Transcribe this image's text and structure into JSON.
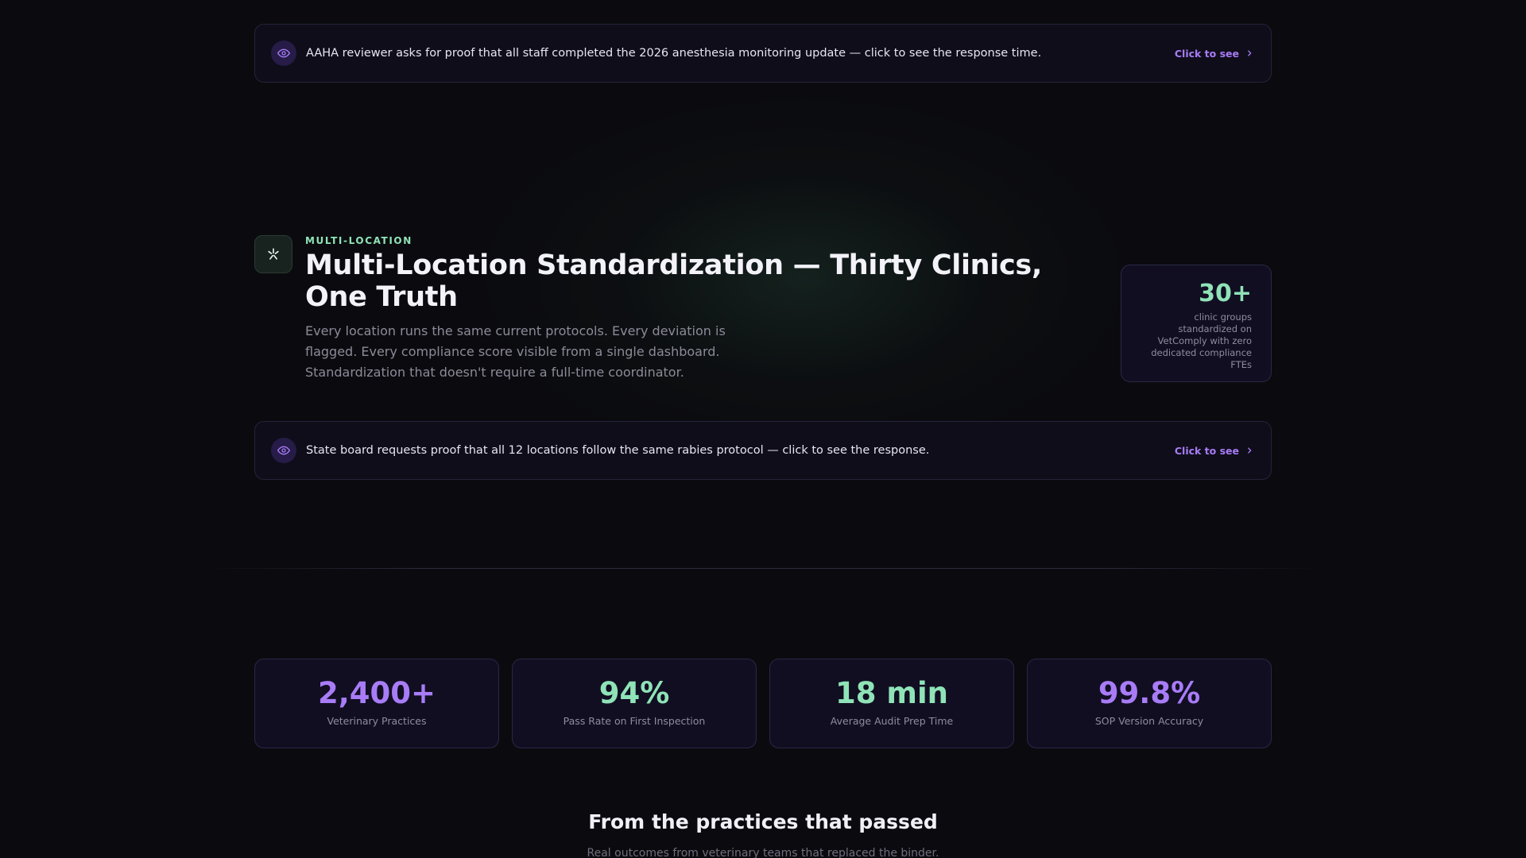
{
  "callout_top": {
    "icon": "eye-icon",
    "text": "AAHA reviewer asks for proof that all staff completed the 2026 anesthesia monitoring update — click to see the response time.",
    "cta_label": "Click to see"
  },
  "feature": {
    "icon": "sparkle-icon",
    "eyebrow": "MULTI-LOCATION",
    "title": "Multi-Location Standardization — Thirty Clinics, One Truth",
    "description": "Every location runs the same current protocols. Every deviation is flagged. Every compliance score visible from a single dashboard. Standardization that doesn't require a full-time coordinator.",
    "stat": {
      "value": "30+",
      "caption": "clinic groups standardized on VetComply with zero dedicated compliance FTEs"
    }
  },
  "callout_bottom": {
    "icon": "eye-icon",
    "text": "State board requests proof that all 12 locations follow the same rabies protocol — click to see the response.",
    "cta_label": "Click to see"
  },
  "metrics": [
    {
      "value": "2,400+",
      "label": "Veterinary Practices",
      "color": "#a87cf7"
    },
    {
      "value": "94%",
      "label": "Pass Rate on First Inspection",
      "color": "#8fe3b7"
    },
    {
      "value": "18 min",
      "label": "Average Audit Prep Time",
      "color": "#8fe3b7"
    },
    {
      "value": "99.8%",
      "label": "SOP Version Accuracy",
      "color": "#a87cf7"
    }
  ],
  "testimonials": {
    "title": "From the practices that passed",
    "subtitle": "Real outcomes from veterinary teams that replaced the binder."
  },
  "colors": {
    "accent_purple": "#a87cf7",
    "accent_green": "#8fe3b7",
    "background": "#0b0b0f"
  }
}
